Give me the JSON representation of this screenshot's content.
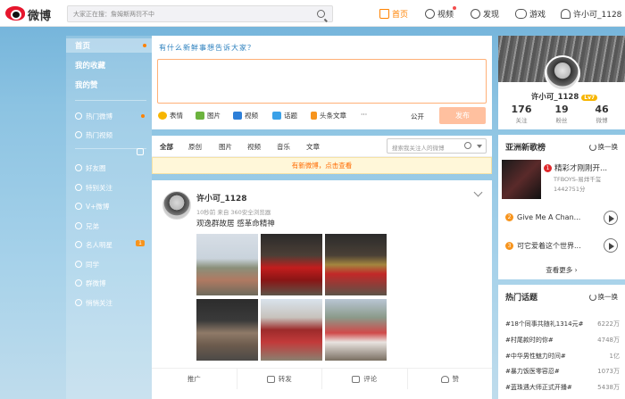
{
  "header": {
    "logo_text": "微博",
    "search_placeholder": "大家正在搜：詹姆斯两罚不中",
    "nav": [
      {
        "label": "首页",
        "icon": "home-icon"
      },
      {
        "label": "视频",
        "icon": "video-icon"
      },
      {
        "label": "发现",
        "icon": "compass-icon"
      },
      {
        "label": "游戏",
        "icon": "gamepad-icon"
      },
      {
        "label": "许小可_1128",
        "icon": "user-icon"
      }
    ]
  },
  "sidebar": {
    "main_items": [
      "首页",
      "我的收藏",
      "我的赞"
    ],
    "group_items": [
      {
        "label": "热门微博",
        "icon": "fire-icon"
      },
      {
        "label": "热门视频",
        "icon": "play-icon"
      }
    ],
    "friend_items": [
      {
        "label": "好友圈"
      },
      {
        "label": "特别关注"
      },
      {
        "label": "V+微博"
      },
      {
        "label": "兄弟"
      },
      {
        "label": "名人明星",
        "count": "1"
      },
      {
        "label": "同学"
      },
      {
        "label": "群微博"
      },
      {
        "label": "悄悄关注"
      }
    ]
  },
  "composer": {
    "prompt": "有什么新鲜事想告诉大家？",
    "tools": [
      "表情",
      "图片",
      "视频",
      "话题",
      "头条文章",
      "···"
    ],
    "visibility": "公开",
    "send_label": "发布"
  },
  "feed_tabs": {
    "tabs": [
      "全部",
      "原创",
      "图片",
      "视频",
      "音乐",
      "文章"
    ],
    "search_placeholder": "搜索我关注人的微博",
    "new_notice": "有新微博，点击查看"
  },
  "post": {
    "username": "许小可_1128",
    "meta": "10秒前 来自 360安全浏览器",
    "text": "观逸群故居 感革命精神",
    "actions": [
      "推广",
      "转发",
      "评论",
      "赞"
    ]
  },
  "profile": {
    "name": "许小可_1128",
    "level": "Lv7",
    "stats": [
      {
        "value": "176",
        "label": "关注"
      },
      {
        "value": "19",
        "label": "粉丝"
      },
      {
        "value": "46",
        "label": "微博"
      }
    ]
  },
  "music": {
    "title": "亚洲新歌榜",
    "refresh": "换一换",
    "songs": [
      {
        "rank": "1",
        "title": "精彩才刚刚开...",
        "artist": "TFBOYS-易烊千玺",
        "plays": "1442751分"
      },
      {
        "rank": "2",
        "title": "Give Me A Chan..."
      },
      {
        "rank": "3",
        "title": "可它爱着这个世界..."
      }
    ],
    "more": "查看更多 ›"
  },
  "topics": {
    "title": "热门话题",
    "refresh": "换一换",
    "items": [
      {
        "name": "#18个同事共随礼1314元#",
        "count": "6222万"
      },
      {
        "name": "#村尾款时的你#",
        "count": "4748万"
      },
      {
        "name": "#中华男性魅力时间#",
        "count": "1亿"
      },
      {
        "name": "#暴力饭医零容忍#",
        "count": "1073万"
      },
      {
        "name": "#蓝珠遇大师正式开播#",
        "count": "5438万"
      }
    ]
  }
}
